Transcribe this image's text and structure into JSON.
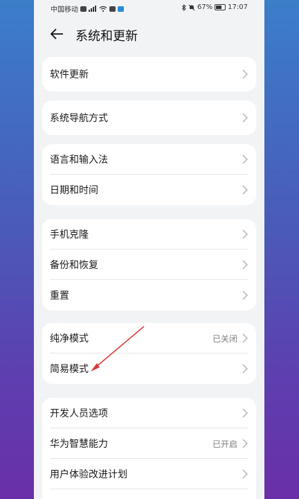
{
  "status_bar": {
    "carrier": "中国移动",
    "battery": "67%",
    "time": "17:07"
  },
  "header": {
    "title": "系统和更新"
  },
  "groups": [
    {
      "items": [
        {
          "label": "软件更新",
          "value": ""
        }
      ]
    },
    {
      "items": [
        {
          "label": "系统导航方式",
          "value": ""
        }
      ]
    },
    {
      "items": [
        {
          "label": "语言和输入法",
          "value": ""
        },
        {
          "label": "日期和时间",
          "value": ""
        }
      ]
    },
    {
      "items": [
        {
          "label": "手机克隆",
          "value": ""
        },
        {
          "label": "备份和恢复",
          "value": ""
        },
        {
          "label": "重置",
          "value": ""
        }
      ]
    },
    {
      "items": [
        {
          "label": "纯净模式",
          "value": "已关闭"
        },
        {
          "label": "简易模式",
          "value": ""
        }
      ]
    },
    {
      "items": [
        {
          "label": "开发人员选项",
          "value": ""
        },
        {
          "label": "华为智慧能力",
          "value": "已开启"
        },
        {
          "label": "用户体验改进计划",
          "value": ""
        }
      ]
    }
  ],
  "colors": {
    "accent_arrow": "#d83a3a",
    "page_bg": "#f1f3f5"
  }
}
